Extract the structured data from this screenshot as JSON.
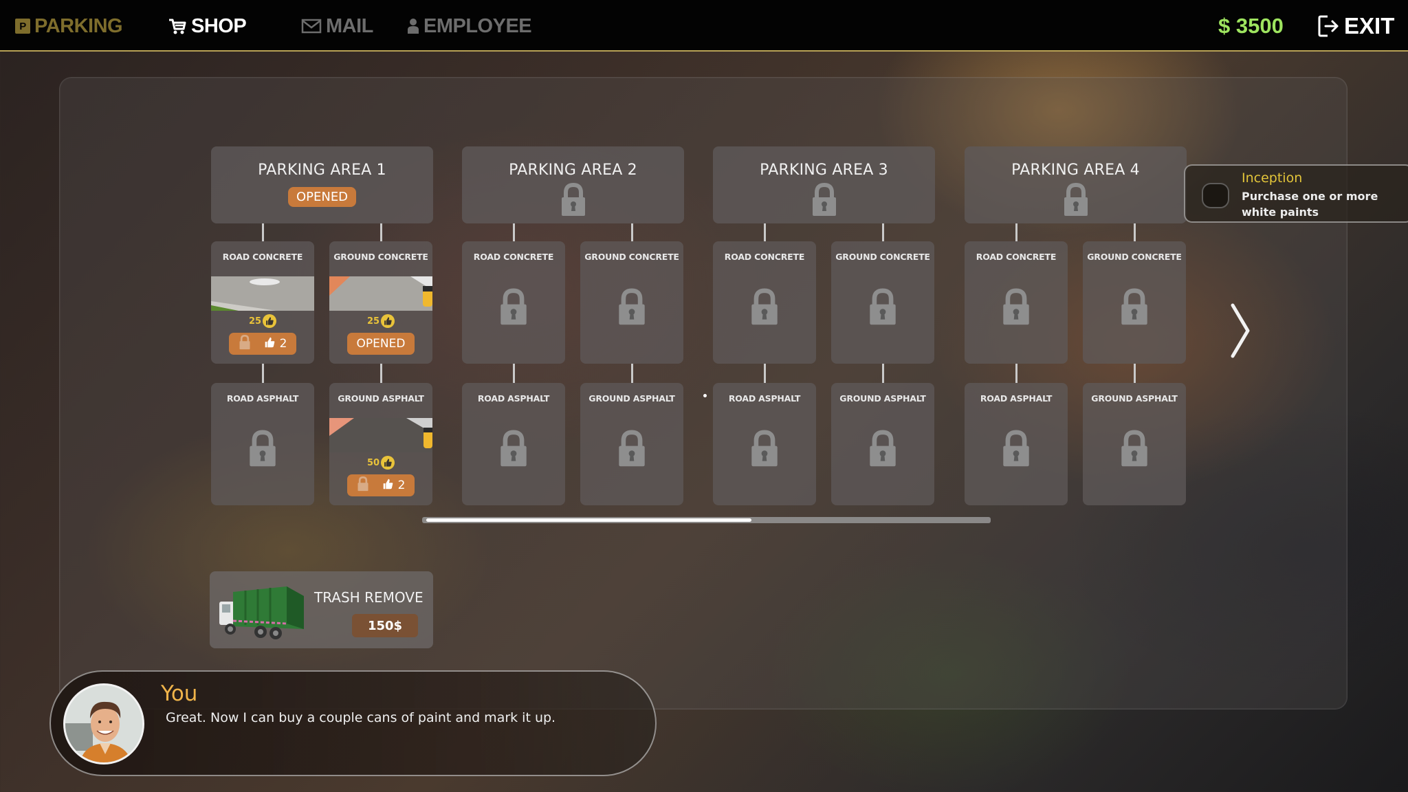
{
  "topbar": {
    "nav": [
      {
        "id": "parking",
        "label": "PARKING",
        "icon": "parking-icon",
        "state": "inactive-highlight"
      },
      {
        "id": "shop",
        "label": "SHOP",
        "icon": "cart-icon",
        "state": "active"
      },
      {
        "id": "mail",
        "label": "MAIL",
        "icon": "mail-icon",
        "state": "inactive"
      },
      {
        "id": "employee",
        "label": "EMPLOYEE",
        "icon": "person-icon",
        "state": "inactive"
      }
    ],
    "parking_badge": "P",
    "money": "$ 3500",
    "exit_label": "EXIT"
  },
  "areas": [
    {
      "title": "PARKING AREA 1",
      "status": "opened",
      "status_label": "OPENED",
      "items": [
        {
          "title": "ROAD CONCRETE",
          "locked": false,
          "image": "road-concrete",
          "likes": "25",
          "action": "unlock",
          "cost": "2"
        },
        {
          "title": "GROUND CONCRETE",
          "locked": false,
          "image": "ground-concrete",
          "likes": "25",
          "action": "opened",
          "action_label": "OPENED"
        },
        {
          "title": "ROAD ASPHALT",
          "locked": true
        },
        {
          "title": "GROUND ASPHALT",
          "locked": false,
          "image": "ground-asphalt",
          "likes": "50",
          "action": "unlock",
          "cost": "2"
        }
      ]
    },
    {
      "title": "PARKING AREA 2",
      "status": "locked",
      "items": [
        {
          "title": "ROAD CONCRETE",
          "locked": true
        },
        {
          "title": "GROUND CONCRETE",
          "locked": true
        },
        {
          "title": "ROAD ASPHALT",
          "locked": true
        },
        {
          "title": "GROUND ASPHALT",
          "locked": true
        }
      ]
    },
    {
      "title": "PARKING AREA 3",
      "status": "locked",
      "items": [
        {
          "title": "ROAD CONCRETE",
          "locked": true
        },
        {
          "title": "GROUND CONCRETE",
          "locked": true
        },
        {
          "title": "ROAD ASPHALT",
          "locked": true
        },
        {
          "title": "GROUND ASPHALT",
          "locked": true
        }
      ]
    },
    {
      "title": "PARKING AREA 4",
      "status": "locked",
      "items": [
        {
          "title": "ROAD CONCRETE",
          "locked": true
        },
        {
          "title": "GROUND CONCRETE",
          "locked": true
        },
        {
          "title": "ROAD ASPHALT",
          "locked": true
        },
        {
          "title": "GROUND ASPHALT",
          "locked": true
        }
      ]
    }
  ],
  "scroll": {
    "position_fraction": 0.58
  },
  "trash": {
    "title": "TRASH REMOVE",
    "price": "150$"
  },
  "achievement": {
    "title": "Inception",
    "description": "Purchase one or more white paints",
    "completed": false
  },
  "dialog": {
    "speaker": "You",
    "text": "Great. Now I can buy a couple cans of paint and mark it up."
  },
  "colors": {
    "accent_orange": "#c87a3b",
    "money_green": "#9ee45f",
    "gold": "#b9a356",
    "likes_yellow": "#e9c33a",
    "speaker_orange": "#f0b44a"
  }
}
